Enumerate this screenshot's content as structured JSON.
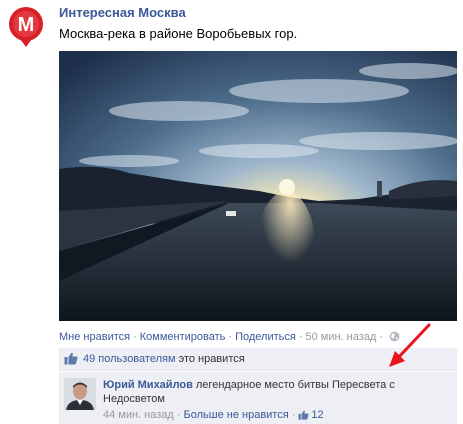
{
  "post": {
    "page_name": "Интересная Москва",
    "logo_letter": "M",
    "text": "Москва-река в районе Воробьевых гор."
  },
  "actions": {
    "like": "Мне нравится",
    "comment": "Комментировать",
    "share": "Поделиться",
    "time": "50 мин. назад",
    "separator": "·",
    "privacy_icon": "globe-icon"
  },
  "likes": {
    "count_link": "49 пользователям",
    "suffix": " это нравится",
    "icon": "thumbs-up-icon"
  },
  "comment": {
    "author": "Юрий Михайлов",
    "text": "легендарное место битвы Пересвета с Недосветом",
    "time": "44 мин. назад",
    "unlike": "Больше не нравится",
    "like_count": "12"
  },
  "colors": {
    "link": "#3b5998",
    "logo_red": "#d61f26",
    "panel": "#edeff4",
    "arrow": "#e8151c"
  }
}
